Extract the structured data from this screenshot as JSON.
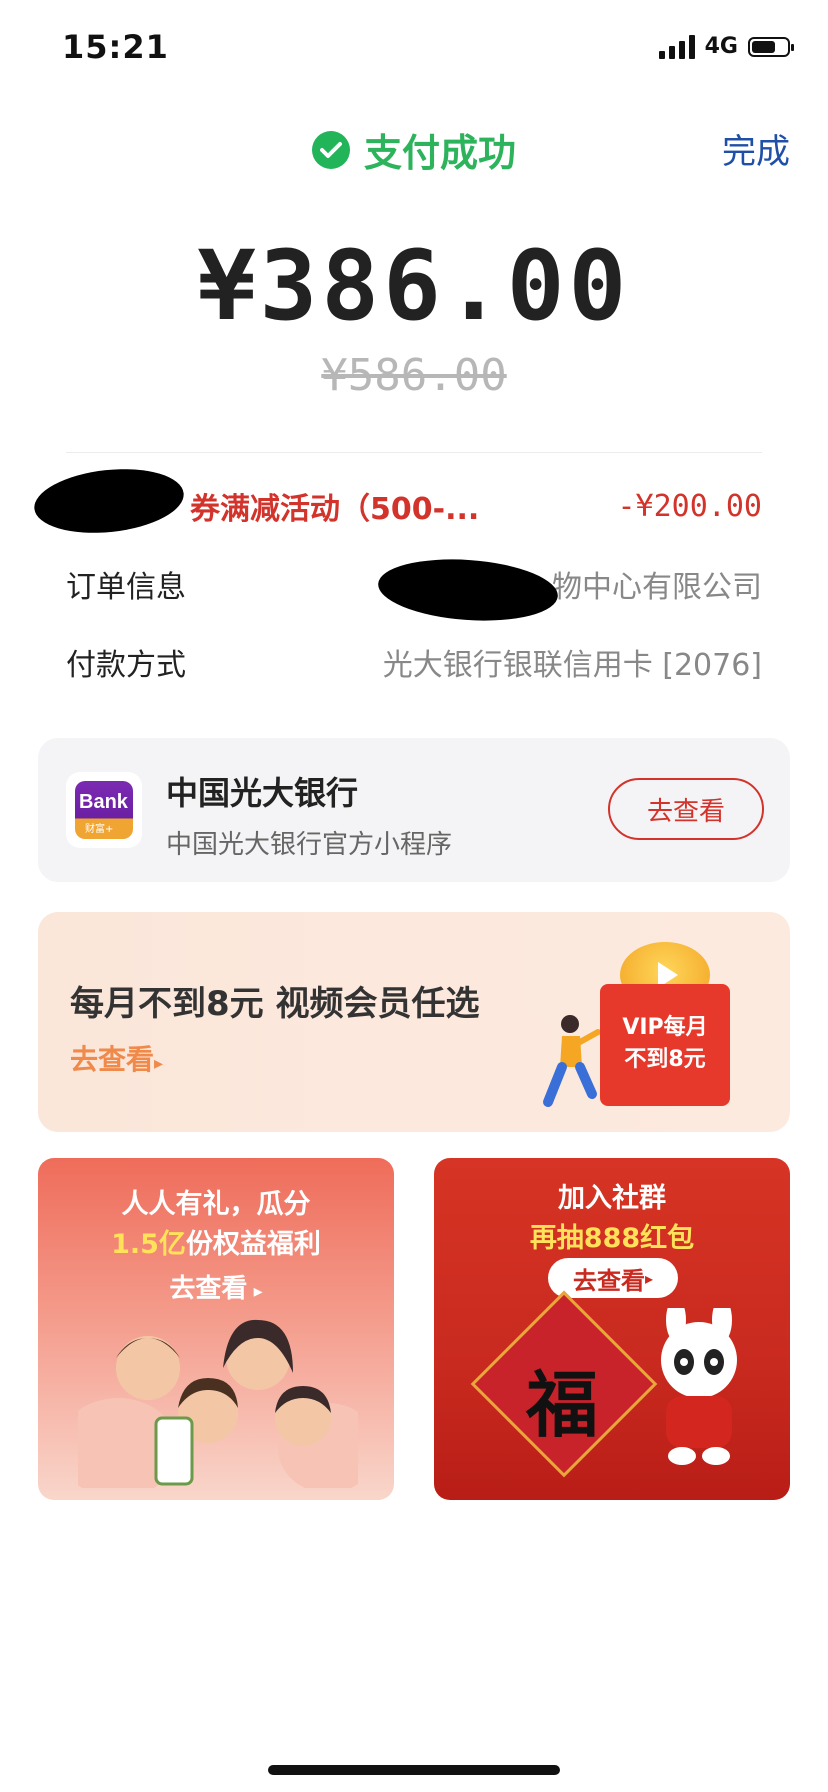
{
  "status_bar": {
    "time": "15:21",
    "network": "4G"
  },
  "header": {
    "title": "支付成功",
    "done_label": "完成"
  },
  "payment": {
    "amount": "¥386.00",
    "original_amount": "¥586.00"
  },
  "details": {
    "promo": {
      "label": "券满减活动（500-...",
      "value": "-¥200.00"
    },
    "order": {
      "label": "订单信息",
      "value": "物中心有限公司"
    },
    "method": {
      "label": "付款方式",
      "value": "光大银行银联信用卡 [2076]"
    }
  },
  "bank_card": {
    "logo_text": "Bank",
    "logo_sub": "财富+",
    "title": "中国光大银行",
    "subtitle": "中国光大银行官方小程序",
    "button": "去查看"
  },
  "vip_banner": {
    "title": "每月不到8元 视频会员任选",
    "link": "去查看",
    "badge_line1": "VIP每月",
    "badge_line2": "不到8元"
  },
  "promo_left": {
    "line1": "人人有礼，瓜分",
    "line2_highlight": "1.5亿",
    "line2_rest": "份权益福利",
    "button": "去查看"
  },
  "promo_right": {
    "line1": "加入社群",
    "line2": "再抽888红包",
    "button": "去查看",
    "fu_char": "福"
  },
  "colors": {
    "success": "#2cb35c",
    "link": "#1f4fa6",
    "danger": "#d2332b",
    "accent_orange": "#f08a4b"
  }
}
